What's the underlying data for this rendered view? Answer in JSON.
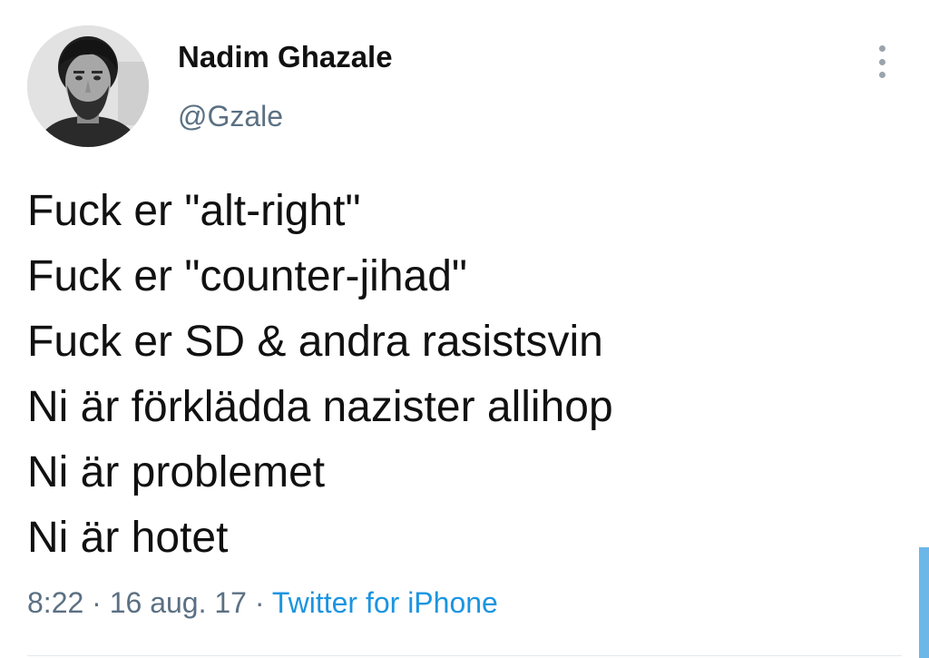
{
  "author": {
    "name": "Nadim Ghazale",
    "handle": "@Gzale"
  },
  "tweet": {
    "lines": [
      "Fuck er \"alt-right\"",
      "Fuck er \"counter-jihad\"",
      "Fuck er SD & andra rasistsvin",
      "Ni är förklädda nazister allihop",
      "Ni är problemet",
      "Ni är hotet"
    ]
  },
  "meta": {
    "time": "8:22",
    "separator": " · ",
    "date": "16 aug. 17",
    "source": "Twitter for iPhone"
  },
  "colors": {
    "text": "#111111",
    "secondary": "#5b7083",
    "link": "#1b95e0"
  },
  "icons": {
    "more": "more-vertical-icon"
  }
}
